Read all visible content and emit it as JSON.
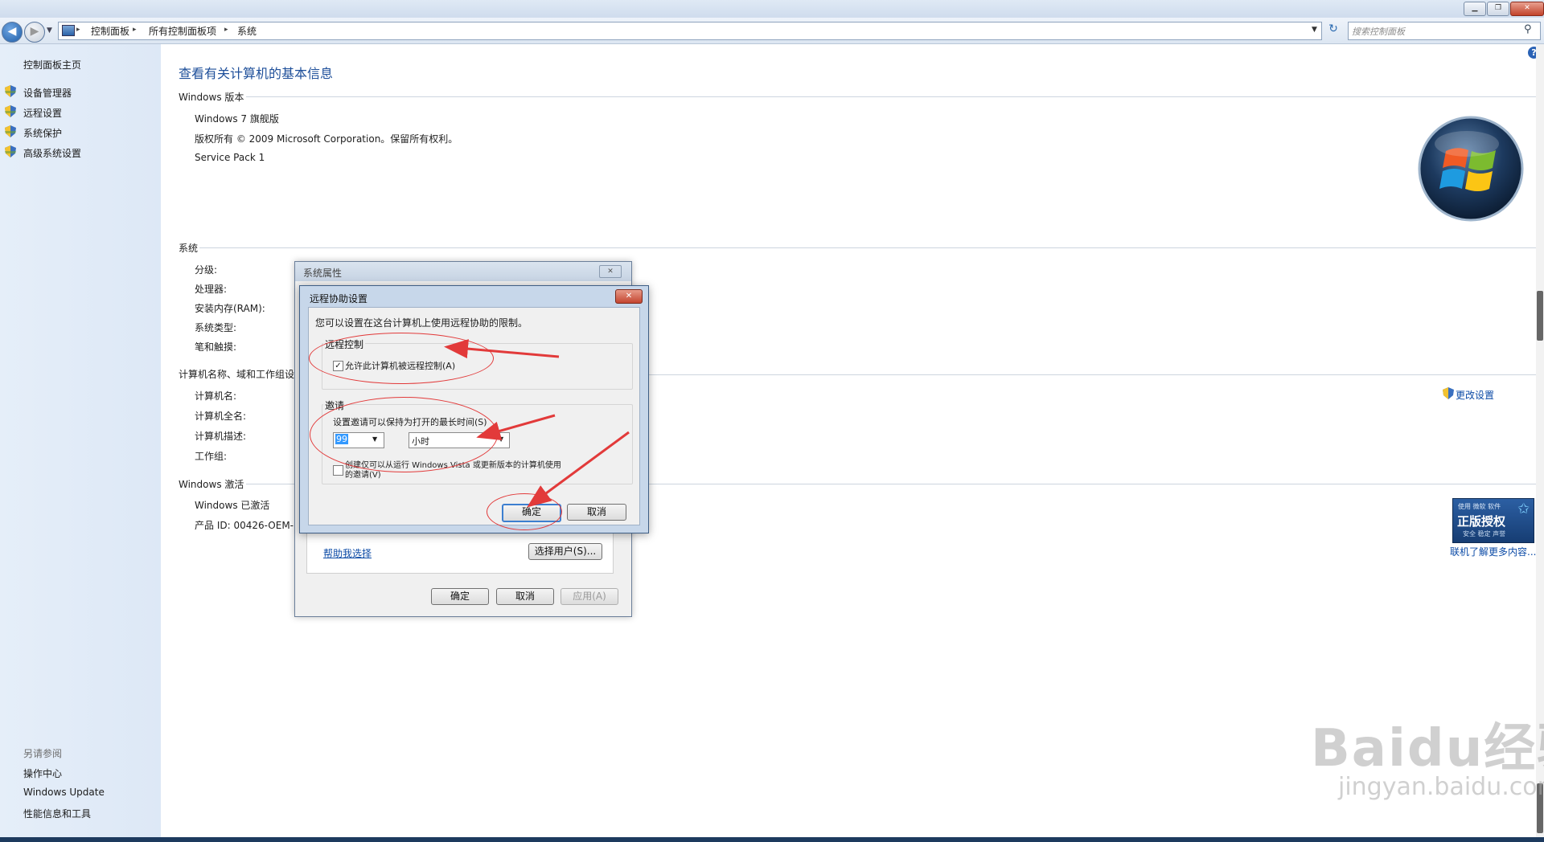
{
  "window": {
    "minimize": "▁",
    "maximize": "❐",
    "close": "✕"
  },
  "navbar": {
    "breadcrumbs": [
      "控制面板",
      "所有控制面板项",
      "系统"
    ],
    "search_placeholder": "搜索控制面板"
  },
  "sidebar": {
    "home": "控制面板主页",
    "items": [
      "设备管理器",
      "远程设置",
      "系统保护",
      "高级系统设置"
    ],
    "see_also_title": "另请参阅",
    "see_also": [
      "操作中心",
      "Windows Update",
      "性能信息和工具"
    ]
  },
  "main": {
    "title": "查看有关计算机的基本信息",
    "windows_edition_heading": "Windows 版本",
    "edition": "Windows 7 旗舰版",
    "copyright": "版权所有 © 2009 Microsoft Corporation。保留所有权利。",
    "service_pack": "Service Pack 1",
    "system_heading": "系统",
    "system_labels": [
      "分级:",
      "处理器:",
      "安装内存(RAM):",
      "系统类型:",
      "笔和触摸:"
    ],
    "computer_heading": "计算机名称、域和工作组设",
    "computer_labels": [
      "计算机名:",
      "计算机全名:",
      "计算机描述:",
      "工作组:"
    ],
    "change_settings": "更改设置",
    "activation_heading": "Windows 激活",
    "activated": "Windows 已激活",
    "product_id": "产品 ID: 00426-OEM-",
    "genuine_top": "使用 微软 软件",
    "genuine_main": "正版授权",
    "genuine_sub": "安全 稳定 声誉",
    "learn_more": "联机了解更多内容..."
  },
  "sysprops": {
    "title": "系统属性",
    "close": "✕",
    "help_link": "帮助我选择",
    "select_users": "选择用户(S)...",
    "ok": "确定",
    "cancel": "取消",
    "apply": "应用(A)"
  },
  "remote_dialog": {
    "title": "远程协助设置",
    "close": "✕",
    "intro": "您可以设置在这台计算机上使用远程协助的限制。",
    "remote_control_group": "远程控制",
    "allow_remote_control": "允许此计算机被远程控制(A)",
    "allow_checked": true,
    "invitation_group": "邀请",
    "invite_time_label": "设置邀请可以保持为打开的最长时间(S)",
    "invite_value": "99",
    "invite_unit": "小时",
    "vista_option_line1": "创建仅可以从运行 Windows Vista 或更新版本的计算机使用",
    "vista_option_line2": "的邀请(V)",
    "vista_checked": false,
    "ok": "确定",
    "cancel": "取消"
  },
  "watermark": {
    "brand": "Baidu经验",
    "url": "jingyan.baidu.com"
  },
  "colors": {
    "link": "#0b4aa6",
    "title_blue": "#1e4f9a",
    "annotation_red": "#e23a3a"
  }
}
